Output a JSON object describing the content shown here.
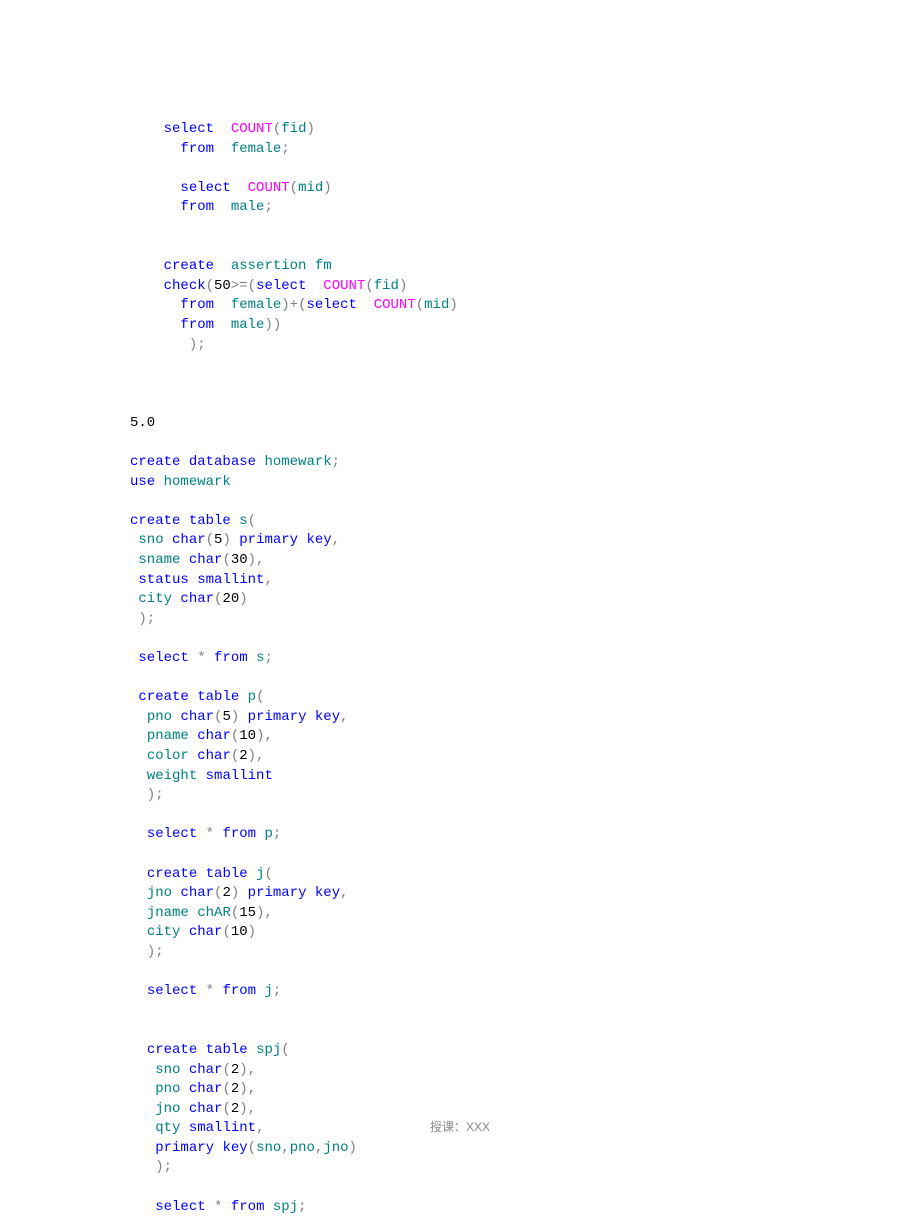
{
  "footer": "授课：XXX",
  "code": {
    "section_heading": "5.0",
    "lines": [
      {
        "indent": 4,
        "tokens": [
          [
            "kw",
            "select"
          ],
          [
            "nm",
            "  "
          ],
          [
            "fn",
            "COUNT"
          ],
          [
            "op",
            "("
          ],
          [
            "id",
            "fid"
          ],
          [
            "op",
            ")"
          ]
        ]
      },
      {
        "indent": 6,
        "tokens": [
          [
            "kw",
            "from"
          ],
          [
            "nm",
            "  "
          ],
          [
            "id",
            "female"
          ],
          [
            "op",
            ";"
          ]
        ]
      },
      {
        "indent": 0,
        "tokens": []
      },
      {
        "indent": 6,
        "tokens": [
          [
            "kw",
            "select"
          ],
          [
            "nm",
            "  "
          ],
          [
            "fn",
            "COUNT"
          ],
          [
            "op",
            "("
          ],
          [
            "id",
            "mid"
          ],
          [
            "op",
            ")"
          ]
        ]
      },
      {
        "indent": 6,
        "tokens": [
          [
            "kw",
            "from"
          ],
          [
            "nm",
            "  "
          ],
          [
            "id",
            "male"
          ],
          [
            "op",
            ";"
          ]
        ]
      },
      {
        "indent": 0,
        "tokens": []
      },
      {
        "indent": 0,
        "tokens": []
      },
      {
        "indent": 4,
        "tokens": [
          [
            "kw",
            "create"
          ],
          [
            "nm",
            "  "
          ],
          [
            "id",
            "assertion"
          ],
          [
            "nm",
            " "
          ],
          [
            "id",
            "fm"
          ]
        ]
      },
      {
        "indent": 4,
        "tokens": [
          [
            "kw",
            "check"
          ],
          [
            "op",
            "("
          ],
          [
            "nm",
            "50"
          ],
          [
            "op",
            ">=("
          ],
          [
            "kw",
            "select"
          ],
          [
            "nm",
            "  "
          ],
          [
            "fn",
            "COUNT"
          ],
          [
            "op",
            "("
          ],
          [
            "id",
            "fid"
          ],
          [
            "op",
            ")"
          ]
        ]
      },
      {
        "indent": 6,
        "tokens": [
          [
            "kw",
            "from"
          ],
          [
            "nm",
            "  "
          ],
          [
            "id",
            "female"
          ],
          [
            "op",
            ")+("
          ],
          [
            "kw",
            "select"
          ],
          [
            "nm",
            "  "
          ],
          [
            "fn",
            "COUNT"
          ],
          [
            "op",
            "("
          ],
          [
            "id",
            "mid"
          ],
          [
            "op",
            ")"
          ]
        ]
      },
      {
        "indent": 6,
        "tokens": [
          [
            "kw",
            "from"
          ],
          [
            "nm",
            "  "
          ],
          [
            "id",
            "male"
          ],
          [
            "op",
            "))"
          ]
        ]
      },
      {
        "indent": 7,
        "tokens": [
          [
            "op",
            ");"
          ]
        ]
      },
      {
        "indent": 0,
        "tokens": []
      },
      {
        "indent": 0,
        "tokens": []
      },
      {
        "indent": 0,
        "tokens": []
      },
      {
        "indent": 0,
        "tokens": [
          [
            "nm",
            "5.0"
          ]
        ]
      },
      {
        "indent": 0,
        "tokens": []
      },
      {
        "indent": 0,
        "tokens": [
          [
            "kw",
            "create"
          ],
          [
            "nm",
            " "
          ],
          [
            "kw",
            "database"
          ],
          [
            "nm",
            " "
          ],
          [
            "id",
            "homewark"
          ],
          [
            "op",
            ";"
          ]
        ]
      },
      {
        "indent": 0,
        "tokens": [
          [
            "kw",
            "use"
          ],
          [
            "nm",
            " "
          ],
          [
            "id",
            "homewark"
          ]
        ]
      },
      {
        "indent": 0,
        "tokens": []
      },
      {
        "indent": 0,
        "tokens": [
          [
            "kw",
            "create"
          ],
          [
            "nm",
            " "
          ],
          [
            "kw",
            "table"
          ],
          [
            "nm",
            " "
          ],
          [
            "id",
            "s"
          ],
          [
            "op",
            "("
          ]
        ]
      },
      {
        "indent": 1,
        "tokens": [
          [
            "id",
            "sno"
          ],
          [
            "nm",
            " "
          ],
          [
            "kw",
            "char"
          ],
          [
            "op",
            "("
          ],
          [
            "nm",
            "5"
          ],
          [
            "op",
            ")"
          ],
          [
            "nm",
            " "
          ],
          [
            "kw",
            "primary"
          ],
          [
            "nm",
            " "
          ],
          [
            "kw",
            "key"
          ],
          [
            "op",
            ","
          ]
        ]
      },
      {
        "indent": 1,
        "tokens": [
          [
            "id",
            "sname"
          ],
          [
            "nm",
            " "
          ],
          [
            "kw",
            "char"
          ],
          [
            "op",
            "("
          ],
          [
            "nm",
            "30"
          ],
          [
            "op",
            "),"
          ]
        ]
      },
      {
        "indent": 1,
        "tokens": [
          [
            "kw",
            "status"
          ],
          [
            "nm",
            " "
          ],
          [
            "kw",
            "smallint"
          ],
          [
            "op",
            ","
          ]
        ]
      },
      {
        "indent": 1,
        "tokens": [
          [
            "id",
            "city"
          ],
          [
            "nm",
            " "
          ],
          [
            "kw",
            "char"
          ],
          [
            "op",
            "("
          ],
          [
            "nm",
            "20"
          ],
          [
            "op",
            ")"
          ]
        ]
      },
      {
        "indent": 1,
        "tokens": [
          [
            "op",
            ");"
          ]
        ]
      },
      {
        "indent": 0,
        "tokens": []
      },
      {
        "indent": 1,
        "tokens": [
          [
            "kw",
            "select"
          ],
          [
            "nm",
            " "
          ],
          [
            "op",
            "*"
          ],
          [
            "nm",
            " "
          ],
          [
            "kw",
            "from"
          ],
          [
            "nm",
            " "
          ],
          [
            "id",
            "s"
          ],
          [
            "op",
            ";"
          ]
        ]
      },
      {
        "indent": 0,
        "tokens": []
      },
      {
        "indent": 1,
        "tokens": [
          [
            "kw",
            "create"
          ],
          [
            "nm",
            " "
          ],
          [
            "kw",
            "table"
          ],
          [
            "nm",
            " "
          ],
          [
            "id",
            "p"
          ],
          [
            "op",
            "("
          ]
        ]
      },
      {
        "indent": 2,
        "tokens": [
          [
            "id",
            "pno"
          ],
          [
            "nm",
            " "
          ],
          [
            "kw",
            "char"
          ],
          [
            "op",
            "("
          ],
          [
            "nm",
            "5"
          ],
          [
            "op",
            ")"
          ],
          [
            "nm",
            " "
          ],
          [
            "kw",
            "primary"
          ],
          [
            "nm",
            " "
          ],
          [
            "kw",
            "key"
          ],
          [
            "op",
            ","
          ]
        ]
      },
      {
        "indent": 2,
        "tokens": [
          [
            "id",
            "pname"
          ],
          [
            "nm",
            " "
          ],
          [
            "kw",
            "char"
          ],
          [
            "op",
            "("
          ],
          [
            "nm",
            "10"
          ],
          [
            "op",
            "),"
          ]
        ]
      },
      {
        "indent": 2,
        "tokens": [
          [
            "id",
            "color"
          ],
          [
            "nm",
            " "
          ],
          [
            "kw",
            "char"
          ],
          [
            "op",
            "("
          ],
          [
            "nm",
            "2"
          ],
          [
            "op",
            "),"
          ]
        ]
      },
      {
        "indent": 2,
        "tokens": [
          [
            "id",
            "weight"
          ],
          [
            "nm",
            " "
          ],
          [
            "kw",
            "smallint"
          ]
        ]
      },
      {
        "indent": 2,
        "tokens": [
          [
            "op",
            ");"
          ]
        ]
      },
      {
        "indent": 0,
        "tokens": []
      },
      {
        "indent": 2,
        "tokens": [
          [
            "kw",
            "select"
          ],
          [
            "nm",
            " "
          ],
          [
            "op",
            "*"
          ],
          [
            "nm",
            " "
          ],
          [
            "kw",
            "from"
          ],
          [
            "nm",
            " "
          ],
          [
            "id",
            "p"
          ],
          [
            "op",
            ";"
          ]
        ]
      },
      {
        "indent": 0,
        "tokens": []
      },
      {
        "indent": 2,
        "tokens": [
          [
            "kw",
            "create"
          ],
          [
            "nm",
            " "
          ],
          [
            "kw",
            "table"
          ],
          [
            "nm",
            " "
          ],
          [
            "id",
            "j"
          ],
          [
            "op",
            "("
          ]
        ]
      },
      {
        "indent": 2,
        "tokens": [
          [
            "id",
            "jno"
          ],
          [
            "nm",
            " "
          ],
          [
            "kw",
            "char"
          ],
          [
            "op",
            "("
          ],
          [
            "nm",
            "2"
          ],
          [
            "op",
            ")"
          ],
          [
            "nm",
            " "
          ],
          [
            "kw",
            "primary"
          ],
          [
            "nm",
            " "
          ],
          [
            "kw",
            "key"
          ],
          [
            "op",
            ","
          ]
        ]
      },
      {
        "indent": 2,
        "tokens": [
          [
            "id",
            "jname"
          ],
          [
            "nm",
            " "
          ],
          [
            "id",
            "chAR"
          ],
          [
            "op",
            "("
          ],
          [
            "nm",
            "15"
          ],
          [
            "op",
            "),"
          ]
        ]
      },
      {
        "indent": 2,
        "tokens": [
          [
            "id",
            "city"
          ],
          [
            "nm",
            " "
          ],
          [
            "kw",
            "char"
          ],
          [
            "op",
            "("
          ],
          [
            "nm",
            "10"
          ],
          [
            "op",
            ")"
          ]
        ]
      },
      {
        "indent": 2,
        "tokens": [
          [
            "op",
            ");"
          ]
        ]
      },
      {
        "indent": 0,
        "tokens": []
      },
      {
        "indent": 2,
        "tokens": [
          [
            "kw",
            "select"
          ],
          [
            "nm",
            " "
          ],
          [
            "op",
            "*"
          ],
          [
            "nm",
            " "
          ],
          [
            "kw",
            "from"
          ],
          [
            "nm",
            " "
          ],
          [
            "id",
            "j"
          ],
          [
            "op",
            ";"
          ]
        ]
      },
      {
        "indent": 0,
        "tokens": []
      },
      {
        "indent": 0,
        "tokens": []
      },
      {
        "indent": 2,
        "tokens": [
          [
            "kw",
            "create"
          ],
          [
            "nm",
            " "
          ],
          [
            "kw",
            "table"
          ],
          [
            "nm",
            " "
          ],
          [
            "id",
            "spj"
          ],
          [
            "op",
            "("
          ]
        ]
      },
      {
        "indent": 3,
        "tokens": [
          [
            "id",
            "sno"
          ],
          [
            "nm",
            " "
          ],
          [
            "kw",
            "char"
          ],
          [
            "op",
            "("
          ],
          [
            "nm",
            "2"
          ],
          [
            "op",
            "),"
          ]
        ]
      },
      {
        "indent": 3,
        "tokens": [
          [
            "id",
            "pno"
          ],
          [
            "nm",
            " "
          ],
          [
            "kw",
            "char"
          ],
          [
            "op",
            "("
          ],
          [
            "nm",
            "2"
          ],
          [
            "op",
            "),"
          ]
        ]
      },
      {
        "indent": 3,
        "tokens": [
          [
            "id",
            "jno"
          ],
          [
            "nm",
            " "
          ],
          [
            "kw",
            "char"
          ],
          [
            "op",
            "("
          ],
          [
            "nm",
            "2"
          ],
          [
            "op",
            "),"
          ]
        ]
      },
      {
        "indent": 3,
        "tokens": [
          [
            "id",
            "qty"
          ],
          [
            "nm",
            " "
          ],
          [
            "kw",
            "smallint"
          ],
          [
            "op",
            ","
          ]
        ]
      },
      {
        "indent": 3,
        "tokens": [
          [
            "kw",
            "primary"
          ],
          [
            "nm",
            " "
          ],
          [
            "kw",
            "key"
          ],
          [
            "op",
            "("
          ],
          [
            "id",
            "sno"
          ],
          [
            "op",
            ","
          ],
          [
            "id",
            "pno"
          ],
          [
            "op",
            ","
          ],
          [
            "id",
            "jno"
          ],
          [
            "op",
            ")"
          ]
        ]
      },
      {
        "indent": 3,
        "tokens": [
          [
            "op",
            ");"
          ]
        ]
      },
      {
        "indent": 0,
        "tokens": []
      },
      {
        "indent": 3,
        "tokens": [
          [
            "kw",
            "select"
          ],
          [
            "nm",
            " "
          ],
          [
            "op",
            "*"
          ],
          [
            "nm",
            " "
          ],
          [
            "kw",
            "from"
          ],
          [
            "nm",
            " "
          ],
          [
            "id",
            "spj"
          ],
          [
            "op",
            ";"
          ]
        ]
      }
    ]
  }
}
